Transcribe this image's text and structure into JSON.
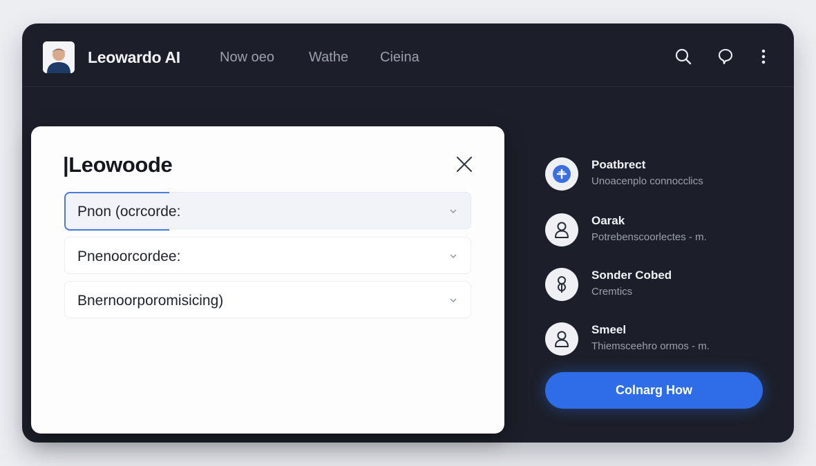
{
  "header": {
    "brand": "Leowardo AI",
    "nav": [
      {
        "label": "Now oeo"
      },
      {
        "label": "Wathe"
      },
      {
        "label": "Cieina"
      }
    ],
    "icons": [
      "search-icon",
      "chat-bubble-icon",
      "more-vertical-icon"
    ]
  },
  "dialog": {
    "title": "|Leowoode",
    "fields": [
      {
        "value": "Pnon (ocrcorde:",
        "active": true
      },
      {
        "value": "Pnenoorcordee:",
        "active": false
      },
      {
        "value": "Bnernoorporomisicing)",
        "active": false
      }
    ]
  },
  "contacts": [
    {
      "name": "Poatbrect",
      "subtitle": "Unoacenplo connocclics",
      "icon": "plus-badge-icon"
    },
    {
      "name": "Oarak",
      "subtitle": "Potrebenscoorlectes - m.",
      "icon": "person-icon"
    },
    {
      "name": "Sonder Cobed",
      "subtitle": "Cremtics",
      "icon": "person-alt-icon"
    },
    {
      "name": "Smeel",
      "subtitle": "Thiemsceehro ormos - m.",
      "icon": "person-icon"
    }
  ],
  "cta": {
    "label": "Colnarg How"
  },
  "colors": {
    "accent": "#2f6de8",
    "window_bg": "#1c1f29",
    "page_bg": "#eceef2"
  }
}
